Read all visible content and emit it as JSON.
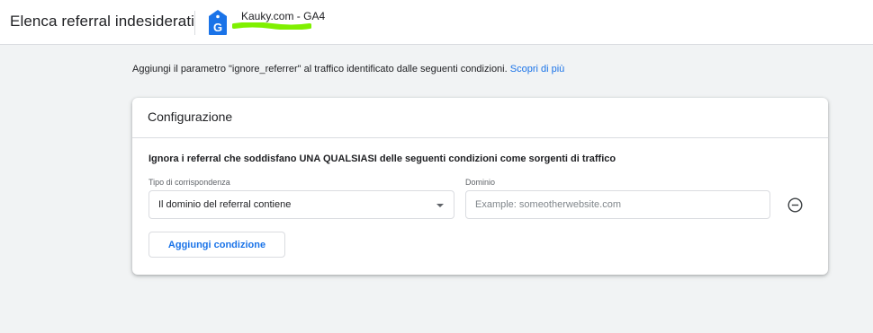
{
  "header": {
    "title": "Elenca referral indesiderati",
    "property_name": "Kauky.com - GA4",
    "property_icon": "ga-property-icon",
    "highlight_color": "#7ff000"
  },
  "intro": {
    "text": "Aggiungi il parametro \"ignore_referrer\" al traffico identificato dalle seguenti condizioni.",
    "link": "Scopri di più"
  },
  "card": {
    "title": "Configurazione",
    "rule_text": "Ignora i referral che soddisfano UNA QUALSIASI delle seguenti condizioni come sorgenti di traffico",
    "match_type_label": "Tipo di corrispondenza",
    "match_type_value": "Il dominio del referral contiene",
    "domain_label": "Dominio",
    "domain_placeholder": "Example: someotherwebsite.com",
    "domain_value": "",
    "remove_icon": "remove-circle-icon",
    "add_condition_label": "Aggiungi condizione"
  },
  "colors": {
    "accent": "#1a73e8",
    "icon_blue": "#1a73e8",
    "background": "#f1f3f4"
  }
}
